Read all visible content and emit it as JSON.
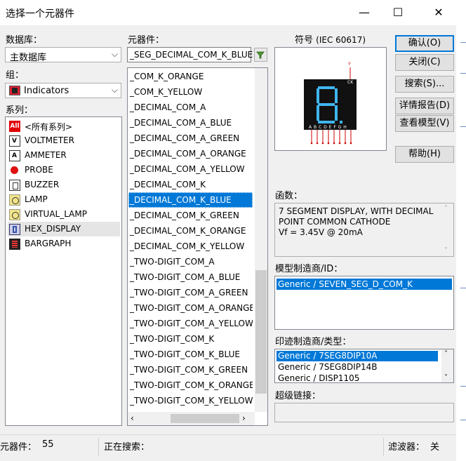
{
  "window": {
    "title": "选择一个元器件",
    "minimize_glyph": "—",
    "maximize_glyph": "☐",
    "close_glyph": "✕"
  },
  "database": {
    "label": "数据库：",
    "value": "主数据库"
  },
  "group": {
    "label": "组：",
    "value": "Indicators",
    "icon": "indicators-icon"
  },
  "family": {
    "label": "系列：",
    "items": [
      {
        "label": "<所有系列>",
        "icon": "all-families-icon",
        "icon_text": "All"
      },
      {
        "label": "VOLTMETER",
        "icon": "voltmeter-icon"
      },
      {
        "label": "AMMETER",
        "icon": "ammeter-icon"
      },
      {
        "label": "PROBE",
        "icon": "probe-icon"
      },
      {
        "label": "BUZZER",
        "icon": "buzzer-icon"
      },
      {
        "label": "LAMP",
        "icon": "lamp-icon"
      },
      {
        "label": "VIRTUAL_LAMP",
        "icon": "virtual-lamp-icon"
      },
      {
        "label": "HEX_DISPLAY",
        "icon": "hex-display-icon"
      },
      {
        "label": "BARGRAPH",
        "icon": "bargraph-icon"
      }
    ],
    "selected_index": 7
  },
  "component": {
    "label": "元器件：",
    "search_value": "_SEG_DECIMAL_COM_K_BLUE",
    "filter_icon": "filter-icon",
    "items": [
      "_COM_K_ORANGE",
      "_COM_K_YELLOW",
      "_DECIMAL_COM_A",
      "_DECIMAL_COM_A_BLUE",
      "_DECIMAL_COM_A_GREEN",
      "_DECIMAL_COM_A_ORANGE",
      "_DECIMAL_COM_A_YELLOW",
      "_DECIMAL_COM_K",
      "_DECIMAL_COM_K_BLUE",
      "_DECIMAL_COM_K_GREEN",
      "_DECIMAL_COM_K_ORANGE",
      "_DECIMAL_COM_K_YELLOW",
      "_TWO-DIGIT_COM_A",
      "_TWO-DIGIT_COM_A_BLUE",
      "_TWO-DIGIT_COM_A_GREEN",
      "_TWO-DIGIT_COM_A_ORANGE",
      "_TWO-DIGIT_COM_A_YELLOW",
      "_TWO-DIGIT_COM_K",
      "_TWO-DIGIT_COM_K_BLUE",
      "_TWO-DIGIT_COM_K_GREEN",
      "_TWO-DIGIT_COM_K_ORANGE",
      "_TWO-DIGIT_COM_K_YELLOW"
    ],
    "selected_index": 8
  },
  "symbol": {
    "label": "符号",
    "standard": "(IEC 60617)",
    "pin_labels": "A B C D E F G H",
    "ck_label": "CK",
    "top_pin_label": "Y",
    "digit_color": "#3fb6f0"
  },
  "buttons": {
    "ok": "确认(O)",
    "close": "关闭(C)",
    "search": "搜索(S)...",
    "detail_report": "详情报告(D)",
    "view_model": "查看模型(V)",
    "help": "帮助(H)"
  },
  "function": {
    "label": "函数：",
    "lines": [
      "7 SEGMENT DISPLAY, WITH DECIMAL",
      "POINT COMMON CATHODE",
      "Vf = 3.45V @ 20mA"
    ]
  },
  "model_mfr": {
    "label": "模型制造商/ID：",
    "items": [
      "Generic / SEVEN_SEG_D_COM_K"
    ],
    "selected_index": 0
  },
  "footprint": {
    "label": "印迹制造商/类型：",
    "items": [
      "Generic / 7SEG8DIP10A",
      "Generic / 7SEG8DIP14B",
      "Generic / DISP1105"
    ],
    "selected_index": 0
  },
  "hyperlink": {
    "label": "超级链接：",
    "value": ""
  },
  "status": {
    "count_label": "元器件：",
    "count_value": "55",
    "searching_label": "正在搜索：",
    "filter_label": "滤波器：",
    "filter_value": "关"
  },
  "colors": {
    "selection": "#0078d7",
    "dialog_bg": "#f0f0f0"
  }
}
